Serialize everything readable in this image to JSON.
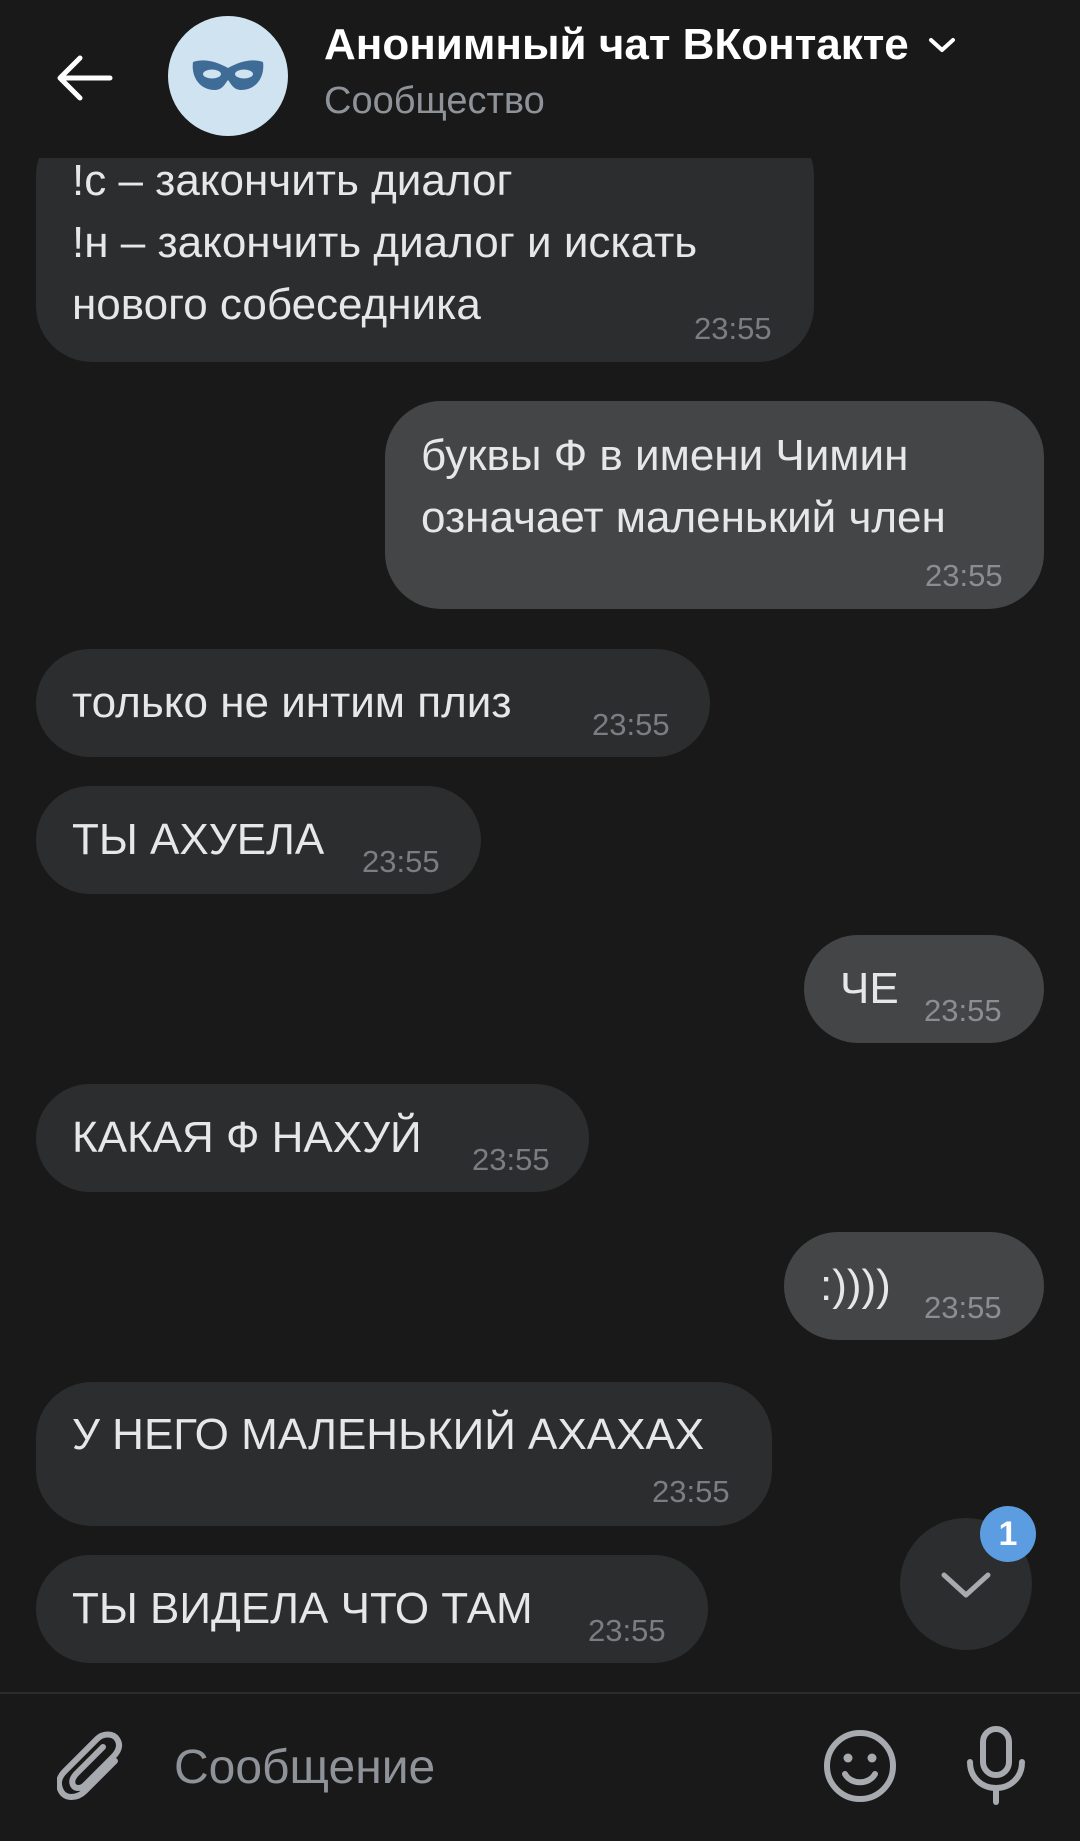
{
  "header": {
    "back_icon": "arrow-left-icon",
    "avatar_icon": "mask-icon",
    "title": "Анонимный чат ВКонтакте",
    "subtitle": "Сообщество",
    "accent_color": "#3f6c96"
  },
  "messages": [
    {
      "direction": "in",
      "text": "!с – закончить диалог\n!н – закончить диалог и искать\nнового собеседника",
      "time": "23:55"
    },
    {
      "direction": "out",
      "text": "буквы Ф в имени Чимин\nозначает маленький член",
      "time": "23:55"
    },
    {
      "direction": "in",
      "text": "только не интим плиз",
      "time": "23:55"
    },
    {
      "direction": "in",
      "text": "ТЫ АХУЕЛА",
      "time": "23:55"
    },
    {
      "direction": "out",
      "text": "ЧЕ",
      "time": "23:55"
    },
    {
      "direction": "in",
      "text": "КАКАЯ Ф НАХУЙ",
      "time": "23:55"
    },
    {
      "direction": "out",
      "text": ":))))",
      "time": "23:55"
    },
    {
      "direction": "in",
      "text": "У НЕГО МАЛЕНЬКИЙ АХАХАХ",
      "time": "23:55"
    },
    {
      "direction": "in",
      "text": "ТЫ ВИДЕЛА ЧТО ТАМ",
      "time": "23:55"
    }
  ],
  "scroll_button": {
    "icon": "chevron-down-icon",
    "unread_count": "1",
    "badge_color": "#5b9de0"
  },
  "composer": {
    "attach_icon": "paperclip-icon",
    "placeholder": "Сообщение",
    "emoji_icon": "smile-icon",
    "mic_icon": "microphone-icon"
  }
}
